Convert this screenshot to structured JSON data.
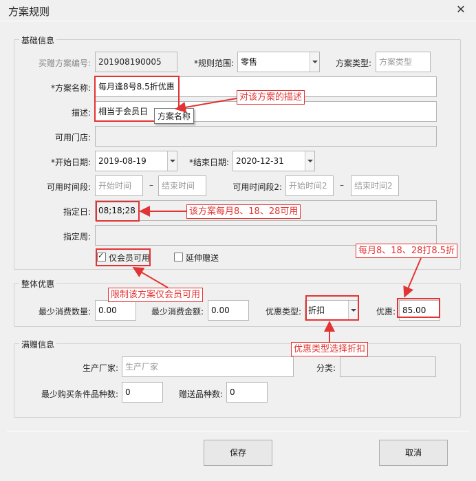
{
  "window": {
    "title": "方案规则",
    "close": "✕"
  },
  "basic": {
    "legend": "基础信息",
    "plan_no_label": "买赠方案编号:",
    "plan_no": "201908190005",
    "scope_label": "*规则范围:",
    "scope": "零售",
    "type_label": "方案类型:",
    "type_placeholder": "方案类型",
    "name_label": "*方案名称:",
    "name": "每月逢8号8.5折优惠",
    "desc_label": "描述:",
    "desc": "相当于会员日",
    "stores_label": "可用门店:",
    "stores": "",
    "start_label": "*开始日期:",
    "start": "2019-08-19",
    "end_label": "*结束日期:",
    "end": "2020-12-31",
    "period1_label": "可用时间段:",
    "p1_start": "开始时间",
    "p1_end": "结束时间",
    "period2_label": "可用时间段2:",
    "p2_start": "开始时间2",
    "p2_end": "结束时间2",
    "dash": "–",
    "days_label": "指定日:",
    "days": "08;18;28",
    "weeks_label": "指定周:",
    "weeks": "",
    "member_only": "仅会员可用",
    "extend_gift": "延伸赠送"
  },
  "overall": {
    "legend": "整体优惠",
    "min_qty_label": "最少消费数量:",
    "min_qty": "0.00",
    "min_amt_label": "最少消费金额:",
    "min_amt": "0.00",
    "disc_type_label": "优惠类型:",
    "disc_type": "折扣",
    "disc_label": "优惠:",
    "disc": "85.00"
  },
  "gift": {
    "legend": "满赠信息",
    "maker_label": "生产厂家:",
    "maker_placeholder": "生产厂家",
    "category_label": "分类:",
    "min_kinds_label": "最少购买条件品种数:",
    "min_kinds": "0",
    "gift_kinds_label": "赠送品种数:",
    "gift_kinds": "0"
  },
  "buttons": {
    "save": "保存",
    "cancel": "取消"
  },
  "annotations": {
    "desc_note": "对该方案的描述",
    "tooltip": "方案名称",
    "days_note": "该方案每月8、18、28可用",
    "member_note": "限制该方案仅会员可用",
    "disc_note": "每月8、18、28打8.5折",
    "type_note": "优惠类型选择折扣",
    "accent": "#e23434"
  }
}
